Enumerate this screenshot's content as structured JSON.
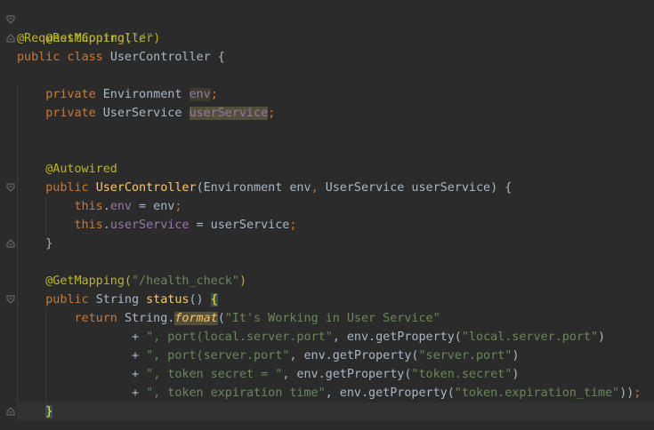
{
  "code": {
    "l1": "@RestController",
    "l2a": "@RequestMapping(",
    "l2b": "\"/\"",
    "l2c": ")",
    "l3a": "public class ",
    "l3b": "UserController {",
    "l5a": "private ",
    "l5b": "Environment ",
    "l5c": "env",
    "l5d": ";",
    "l6a": "private ",
    "l6b": "UserService ",
    "l6c": "userService",
    "l6d": ";",
    "l9": "@Autowired",
    "l10a": "public ",
    "l10b": "UserController",
    "l10c": "(Environment env",
    "l10d": ", ",
    "l10e": "UserService userService) {",
    "l11a": "this",
    "l11b": ".",
    "l11c": "env",
    "l11d": " = env",
    "l11e": ";",
    "l12a": "this",
    "l12b": ".",
    "l12c": "userService",
    "l12d": " = userService",
    "l12e": ";",
    "l13": "}",
    "l15a": "@GetMapping(",
    "l15b": "\"/health_check\"",
    "l15c": ")",
    "l16a": "public ",
    "l16b": "String ",
    "l16c": "status",
    "l16d": "() ",
    "l16e": "{",
    "l17a": "return ",
    "l17b": "String.",
    "l17c": "format",
    "l17d": "(",
    "l17e": "\"It's Working in User Service\"",
    "l18a": "+ ",
    "l18b": "\", port(local.server.port\"",
    "l18c": ", env.getProperty(",
    "l18d": "\"local.server.port\"",
    "l18e": ")",
    "l19a": "+ ",
    "l19b": "\", port(server.port\"",
    "l19c": ", env.getProperty(",
    "l19d": "\"server.port\"",
    "l19e": ")",
    "l20a": "+ ",
    "l20b": "\", token secret = \"",
    "l20c": ", env.getProperty(",
    "l20d": "\"token.secret\"",
    "l20e": ")",
    "l21a": "+ ",
    "l21b": "\", token expiration time\"",
    "l21c": ", env.getProperty(",
    "l21d": "\"token.expiration_time\"",
    "l21e": "))",
    "l21f": ";",
    "l22": "}"
  },
  "colors": {
    "background": "#2b2b2b",
    "keyword": "#cc7832",
    "annotation": "#bbb529",
    "string": "#6a8759",
    "field": "#9876aa",
    "method": "#ffc66d",
    "text": "#a9b7c6"
  },
  "icons": [
    "fold-open-icon",
    "fold-close-icon"
  ]
}
